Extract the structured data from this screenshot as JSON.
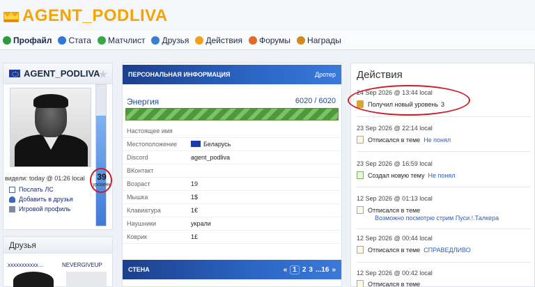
{
  "site": {
    "logo_text": "AGENT_PODLIVA"
  },
  "nav": [
    {
      "label": "Профайл",
      "color": "#2e9c3a"
    },
    {
      "label": "Стата",
      "color": "#2f78d8"
    },
    {
      "label": "Матчлист",
      "color": "#3aa64a"
    },
    {
      "label": "Друзья",
      "color": "#3a7fd0"
    },
    {
      "label": "Действия",
      "color": "#f0a020"
    },
    {
      "label": "Форумы",
      "color": "#e06a2a"
    },
    {
      "label": "Награды",
      "color": "#d08a20"
    }
  ],
  "profile": {
    "name": "AGENT_PODLIVA",
    "seen": "видели: today @ 01:26 local",
    "level": "39",
    "level_label": "уровень",
    "level_fill_fraction": 0.78,
    "links": [
      "Послать ЛС",
      "Добавить в друзья",
      "Игровой профиль"
    ]
  },
  "friends": {
    "title": "Друзья",
    "items": [
      "xxxxxxxxxxx...",
      "NEVERGIVEUP"
    ]
  },
  "personal": {
    "header": "ПЕРСОНАЛЬНАЯ ИНФОРМАЦИЯ",
    "header_right": "Дротер",
    "energy_label": "Энергия",
    "energy_value": "6020 / 6020",
    "rows": [
      {
        "key": "Настоящее имя",
        "value": ""
      },
      {
        "key": "Местоположение",
        "value": "Беларусь"
      },
      {
        "key": "Discord",
        "value": "agent_podliva"
      },
      {
        "key": "ВКонтакт",
        "value": ""
      },
      {
        "key": "Возраст",
        "value": "19"
      },
      {
        "key": "Мышка",
        "value": "1$"
      },
      {
        "key": "Клавиатура",
        "value": "1€"
      },
      {
        "key": "Наушники",
        "value": "украли"
      },
      {
        "key": "Коврик",
        "value": "1£"
      }
    ]
  },
  "wall": {
    "header": "СТЕНА",
    "pager": {
      "prev": "«",
      "active": "1",
      "pages": [
        "2",
        "3",
        "...16"
      ],
      "next": "»"
    }
  },
  "actions": {
    "title": "Действия",
    "items": [
      {
        "date": "24 Sep 2026 @ 13:44 local",
        "text": "Получил новый уровень",
        "link": "3"
      },
      {
        "date": "23 Sep 2026 @ 22:14 local",
        "text": "Отписался в теме",
        "link": "Не понял"
      },
      {
        "date": "23 Sep 2026 @ 16:59 local",
        "text": "Создал новую тему",
        "link": "Не понял"
      },
      {
        "date": "12 Sep 2026 @ 01:13 local",
        "text": "Отписался в теме",
        "link": "Возможно посмотрю стрим Пуси.!.Талкера"
      },
      {
        "date": "12 Sep 2026 @ 00:44 local",
        "text": "Отписался в теме",
        "link": "СПРАВЕДЛИВО"
      },
      {
        "date": "12 Sep 2026 @ 00:42 local",
        "text": "Отписался в теме",
        "link": ""
      }
    ]
  }
}
